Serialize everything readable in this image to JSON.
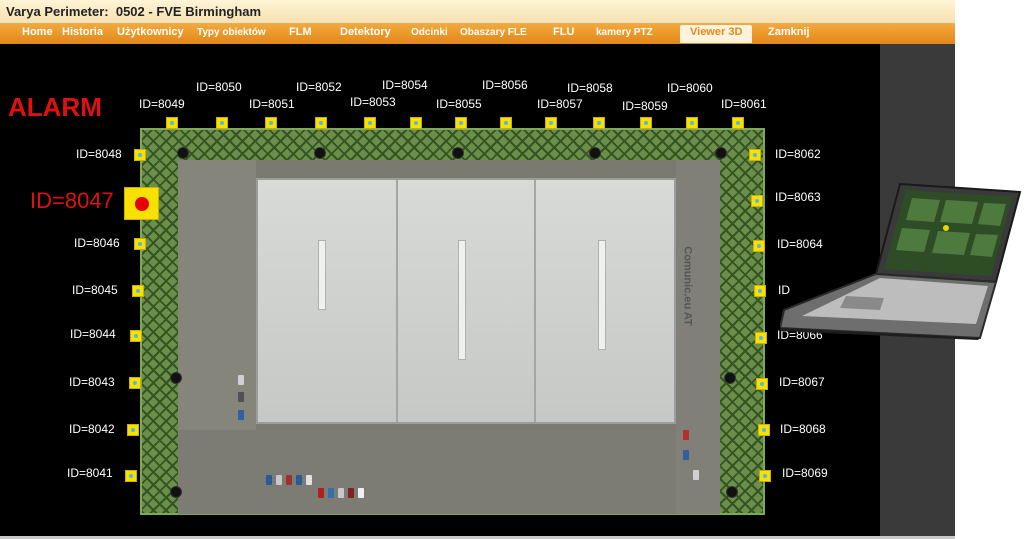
{
  "window": {
    "title": "Varya Perimeter:  0502 - FVE Birmingham"
  },
  "nav": [
    {
      "label": "Home"
    },
    {
      "label": "Historia"
    },
    {
      "label": "Użytkownicy"
    },
    {
      "label": "Typy obiektów"
    },
    {
      "label": "FLM"
    },
    {
      "label": "Detektory"
    },
    {
      "label": "Odcinki"
    },
    {
      "label": "Obaszary FLE"
    },
    {
      "label": "FLU"
    },
    {
      "label": "kamery PTZ"
    },
    {
      "label": "Viewer 3D",
      "active": true
    },
    {
      "label": "Zamknij"
    }
  ],
  "alarm": {
    "title": "ALARM"
  },
  "sensors": {
    "top": [
      {
        "id": "ID=8049"
      },
      {
        "id": "ID=8050"
      },
      {
        "id": "ID=8051"
      },
      {
        "id": "ID=8052"
      },
      {
        "id": "ID=8053"
      },
      {
        "id": "ID=8054"
      },
      {
        "id": "ID=8055"
      },
      {
        "id": "ID=8056"
      },
      {
        "id": "ID=8057"
      },
      {
        "id": "ID=8058"
      },
      {
        "id": "ID=8059"
      },
      {
        "id": "ID=8060"
      },
      {
        "id": "ID=8061"
      }
    ],
    "left": [
      {
        "id": "ID=8048"
      },
      {
        "id": "ID=8047",
        "alarm": true
      },
      {
        "id": "ID=8046"
      },
      {
        "id": "ID=8045"
      },
      {
        "id": "ID=8044"
      },
      {
        "id": "ID=8043"
      },
      {
        "id": "ID=8042"
      },
      {
        "id": "ID=8041"
      }
    ],
    "right": [
      {
        "id": "ID=8062"
      },
      {
        "id": "ID=8063"
      },
      {
        "id": "ID=8064"
      },
      {
        "id": "ID"
      },
      {
        "id": "ID=8066"
      },
      {
        "id": "ID=8067"
      },
      {
        "id": "ID=8068"
      },
      {
        "id": "ID=8069"
      }
    ]
  },
  "map": {
    "roof_text": "Comunic.eu  AT"
  },
  "colors": {
    "nav_bg": "#e8921f",
    "alarm": "#e01010",
    "sensor": "#f8e100",
    "sensor_dot": "#5ab4e8",
    "background": "#000000"
  }
}
